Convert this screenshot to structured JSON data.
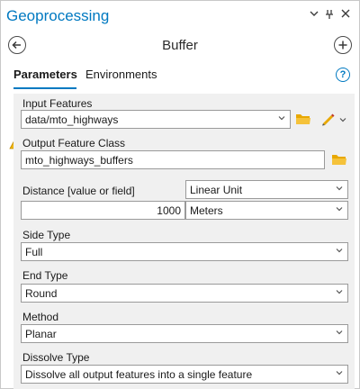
{
  "header": {
    "title": "Geoprocessing",
    "pin_glyph": "⊓",
    "close_glyph": "✕",
    "menu_glyph": "⌄"
  },
  "tool": {
    "name": "Buffer"
  },
  "tabs": [
    {
      "label": "Parameters",
      "active": true
    },
    {
      "label": "Environments",
      "active": false
    }
  ],
  "help_glyph": "?",
  "params": {
    "input_features": {
      "label": "Input Features",
      "value": "data/mto_highways"
    },
    "output_feature_class": {
      "label": "Output Feature Class",
      "value": "mto_highways_buffers",
      "warning": true
    },
    "distance": {
      "label": "Distance [value or field]",
      "mode": "Linear Unit",
      "value": "1000",
      "unit": "Meters"
    },
    "side_type": {
      "label": "Side Type",
      "value": "Full"
    },
    "end_type": {
      "label": "End Type",
      "value": "Round"
    },
    "method": {
      "label": "Method",
      "value": "Planar"
    },
    "dissolve_type": {
      "label": "Dissolve Type",
      "value": "Dissolve all output features into a single feature"
    }
  },
  "colors": {
    "accent": "#0079c1",
    "folder": "#e8a800",
    "warning": "#e8a800"
  },
  "icons": {
    "back": "back-arrow-icon",
    "add": "plus-icon",
    "folder": "folder-icon",
    "pencil": "pencil-icon",
    "warning": "warning-icon",
    "help": "help-icon"
  }
}
